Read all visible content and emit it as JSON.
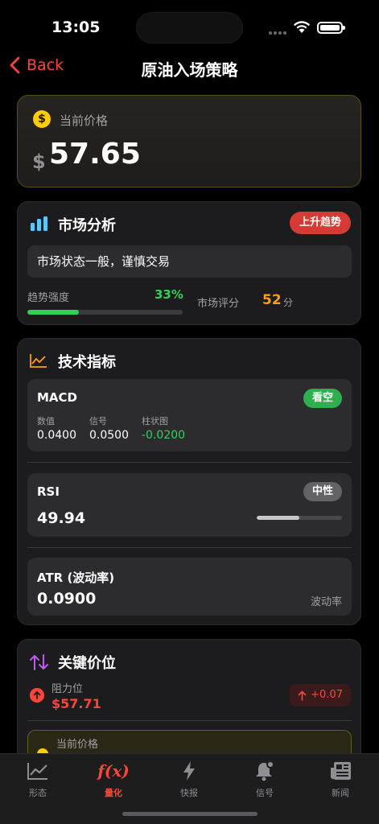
{
  "status": {
    "time": "13:05"
  },
  "nav": {
    "back_label": "Back",
    "title": "原油入场策略"
  },
  "price": {
    "label": "当前价格",
    "currency": "$",
    "value": "57.65"
  },
  "market": {
    "title": "市场分析",
    "badge": "上升趋势",
    "state": "市场状态一般，谨慎交易",
    "trend_label": "趋势强度",
    "trend_pct": "33%",
    "trend_fraction": 0.33,
    "score_label": "市场评分",
    "score_value": "52",
    "score_unit": "分"
  },
  "tech": {
    "title": "技术指标",
    "macd": {
      "title": "MACD",
      "badge": "看空",
      "labels": [
        "数值",
        "信号",
        "柱状图"
      ],
      "values": [
        "0.0400",
        "0.0500",
        "-0.0200"
      ]
    },
    "rsi": {
      "title": "RSI",
      "badge": "中性",
      "value": "49.94",
      "fraction": 0.4994
    },
    "atr": {
      "title": "ATR (波动率)",
      "value": "0.0900",
      "caption": "波动率"
    }
  },
  "key": {
    "title": "关键价位",
    "resistance_label": "阻力位",
    "resistance_value": "$57.71",
    "resistance_delta": "+0.07",
    "current_label": "当前价格"
  },
  "tabs": [
    {
      "label": "形态",
      "icon": "chart-line-icon"
    },
    {
      "label": "量化",
      "icon": "fx-icon"
    },
    {
      "label": "快报",
      "icon": "bolt-icon"
    },
    {
      "label": "信号",
      "icon": "bell-icon"
    },
    {
      "label": "新闻",
      "icon": "newspaper-icon"
    }
  ],
  "colors": {
    "accent_red": "#ff453a",
    "green": "#30d158",
    "orange": "#ff9f0a",
    "gold": "#ffcc00"
  }
}
